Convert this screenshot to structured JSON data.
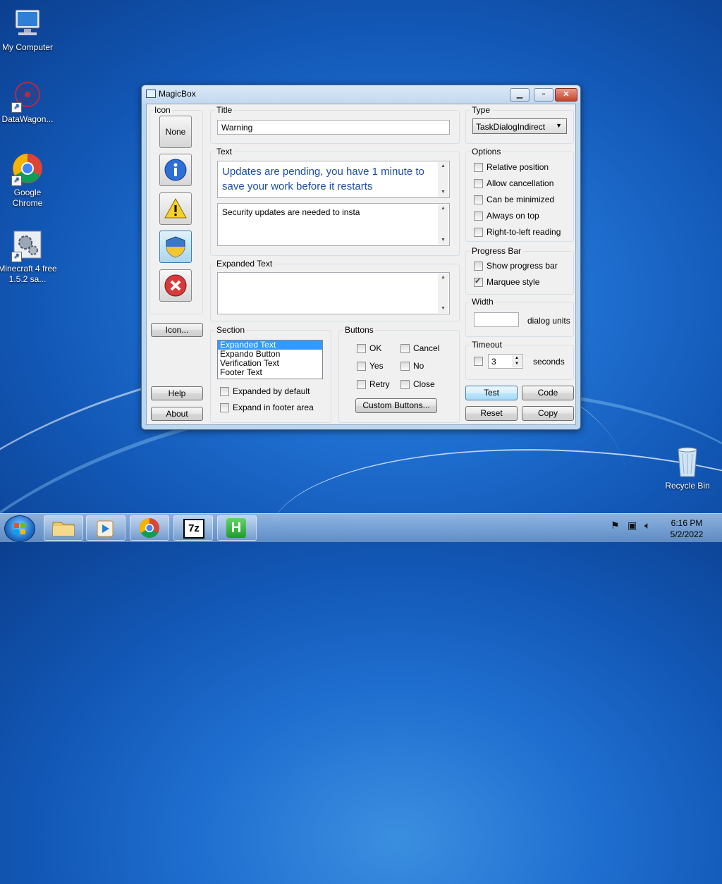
{
  "desktop": {
    "icons": [
      {
        "label": "My Computer"
      },
      {
        "label": "DataWagon..."
      },
      {
        "label": "Google Chrome"
      },
      {
        "label": "Minecraft 4 free 1.5.2 sa..."
      },
      {
        "label": "Recycle Bin"
      }
    ]
  },
  "window": {
    "title": "MagicBox",
    "icon_group": {
      "label": "Icon",
      "none_label": "None",
      "buttons": [
        "info-icon",
        "warning-icon",
        "shield-icon",
        "error-icon"
      ],
      "selected": "shield-icon"
    },
    "title_field": {
      "label": "Title",
      "value": "Warning"
    },
    "text_group": {
      "label": "Text",
      "main_instruction": "Updates are pending, you have 1 minute to save your work before it restarts",
      "content": "Security updates are needed to insta"
    },
    "expanded_text": {
      "label": "Expanded Text",
      "value": ""
    },
    "type_group": {
      "label": "Type",
      "selected": "TaskDialogIndirect"
    },
    "options": {
      "label": "Options",
      "items": [
        {
          "label": "Relative position",
          "checked": false
        },
        {
          "label": "Allow cancellation",
          "checked": false
        },
        {
          "label": "Can be minimized",
          "checked": false
        },
        {
          "label": "Always on top",
          "checked": false
        },
        {
          "label": "Right-to-left reading",
          "checked": false
        }
      ]
    },
    "progress_bar": {
      "label": "Progress Bar",
      "items": [
        {
          "label": "Show progress bar",
          "checked": false
        },
        {
          "label": "Marquee style",
          "checked": true
        }
      ]
    },
    "width": {
      "label": "Width",
      "value": "",
      "units": "dialog units"
    },
    "timeout": {
      "label": "Timeout",
      "value": "3",
      "units": "seconds",
      "checked": false
    },
    "section": {
      "label": "Section",
      "items": [
        "Expanded Text",
        "Expando Button",
        "Verification Text",
        "Footer Text"
      ],
      "selected_index": 0,
      "expanded_by_default": "Expanded by default",
      "expand_in_footer": "Expand in footer area"
    },
    "buttons_group": {
      "label": "Buttons",
      "items": [
        {
          "label": "OK",
          "checked": false
        },
        {
          "label": "Cancel",
          "checked": false
        },
        {
          "label": "Yes",
          "checked": false
        },
        {
          "label": "No",
          "checked": false
        },
        {
          "label": "Retry",
          "checked": false
        },
        {
          "label": "Close",
          "checked": false
        }
      ],
      "custom_label": "Custom Buttons..."
    },
    "left_buttons": {
      "icon": "Icon...",
      "help": "Help",
      "about": "About"
    },
    "action_buttons": {
      "test": "Test",
      "code": "Code",
      "reset": "Reset",
      "copy": "Copy"
    }
  },
  "taskbar": {
    "apps": [
      "folder-icon",
      "media-player-icon",
      "chrome-icon",
      "7zip-icon",
      "h-app-icon"
    ],
    "app_7z_label": "7z",
    "app_h_label": "H",
    "clock": {
      "time": "6:16 PM",
      "date": "5/2/2022"
    }
  }
}
